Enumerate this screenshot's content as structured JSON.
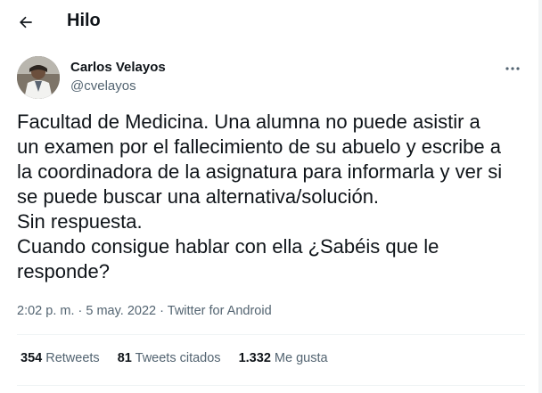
{
  "header": {
    "title": "Hilo",
    "back_icon": "arrow-left-icon"
  },
  "tweet": {
    "author": {
      "name": "Carlos Velayos",
      "handle": "@cvelayos",
      "more_icon": "more-horizontal-icon"
    },
    "lines": [
      "Facultad de Medicina. Una alumna no puede asistir a",
      "un examen por el fallecimiento de su abuelo y escribe a",
      "la coordinadora de la asignatura para informarla y ver si",
      "se puede buscar una alternativa/solución.",
      "Sin respuesta.",
      "Cuando consigue hablar con ella ¿Sabéis que le",
      "responde?"
    ],
    "time": "2:02 p. m.",
    "date": "5 may. 2022",
    "separator": "·",
    "source": "Twitter for Android"
  },
  "stats": {
    "retweets": {
      "count": "354",
      "label": "Retweets"
    },
    "quotes": {
      "count": "81",
      "label": "Tweets citados"
    },
    "likes": {
      "count": "1.332",
      "label": "Me gusta"
    }
  },
  "colors": {
    "text": "#0f1419",
    "secondary": "#536471",
    "divider": "#eff3f4"
  }
}
